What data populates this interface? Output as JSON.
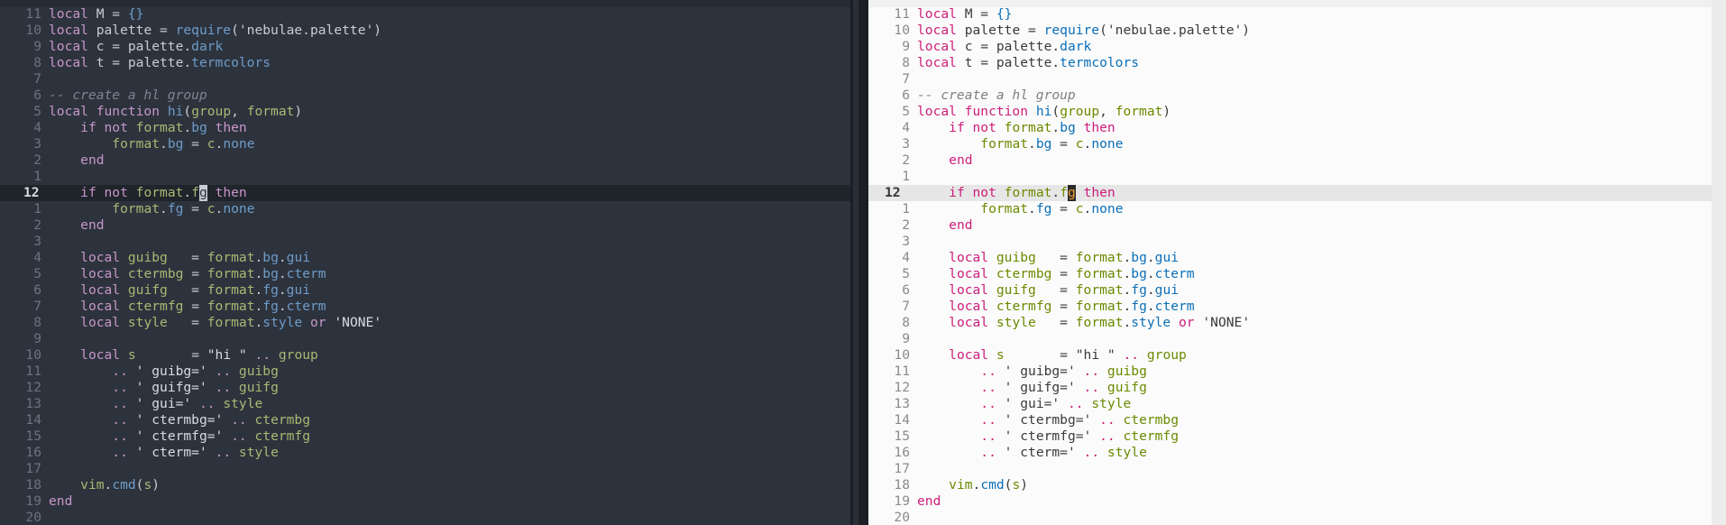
{
  "editor": {
    "lines": [
      {
        "n": "11",
        "parts": [
          [
            "kw",
            "local"
          ],
          [
            "plain",
            " M = "
          ],
          [
            "prop",
            "{}"
          ]
        ]
      },
      {
        "n": "10",
        "parts": [
          [
            "kw",
            "local"
          ],
          [
            "plain",
            " palette = "
          ],
          [
            "prop",
            "require"
          ],
          [
            "plain",
            "('nebulae.palette')"
          ]
        ]
      },
      {
        "n": "9",
        "parts": [
          [
            "kw",
            "local"
          ],
          [
            "plain",
            " c = palette."
          ],
          [
            "prop",
            "dark"
          ]
        ]
      },
      {
        "n": "8",
        "parts": [
          [
            "kw",
            "local"
          ],
          [
            "plain",
            " t = palette."
          ],
          [
            "prop",
            "termcolors"
          ]
        ]
      },
      {
        "n": "7",
        "parts": []
      },
      {
        "n": "6",
        "parts": [
          [
            "cmt",
            "-- create a hl group"
          ]
        ]
      },
      {
        "n": "5",
        "parts": [
          [
            "kw",
            "local function"
          ],
          [
            "plain",
            " "
          ],
          [
            "prop",
            "hi"
          ],
          [
            "plain",
            "("
          ],
          [
            "var",
            "group"
          ],
          [
            "plain",
            ", "
          ],
          [
            "var",
            "format"
          ],
          [
            "plain",
            ")"
          ]
        ]
      },
      {
        "n": "4",
        "parts": [
          [
            "plain",
            "    "
          ],
          [
            "kw",
            "if not"
          ],
          [
            "plain",
            " "
          ],
          [
            "var",
            "format"
          ],
          [
            "plain",
            "."
          ],
          [
            "prop",
            "bg"
          ],
          [
            "plain",
            " "
          ],
          [
            "kw",
            "then"
          ]
        ]
      },
      {
        "n": "3",
        "parts": [
          [
            "plain",
            "        "
          ],
          [
            "var",
            "format"
          ],
          [
            "plain",
            "."
          ],
          [
            "prop",
            "bg"
          ],
          [
            "plain",
            " = "
          ],
          [
            "var",
            "c"
          ],
          [
            "plain",
            "."
          ],
          [
            "prop",
            "none"
          ]
        ]
      },
      {
        "n": "2",
        "parts": [
          [
            "plain",
            "    "
          ],
          [
            "kw",
            "end"
          ]
        ]
      },
      {
        "n": "1",
        "parts": []
      },
      {
        "n": "12",
        "current": true,
        "parts": [
          [
            "plain",
            "    "
          ],
          [
            "kw",
            "if not"
          ],
          [
            "plain",
            " "
          ],
          [
            "var",
            "format"
          ],
          [
            "plain",
            "."
          ],
          [
            "var",
            "f"
          ],
          [
            "cursor",
            "g"
          ],
          [
            "plain",
            " "
          ],
          [
            "kw",
            "then"
          ]
        ]
      },
      {
        "n": "1",
        "parts": [
          [
            "plain",
            "        "
          ],
          [
            "var",
            "format"
          ],
          [
            "plain",
            "."
          ],
          [
            "prop",
            "fg"
          ],
          [
            "plain",
            " = "
          ],
          [
            "var",
            "c"
          ],
          [
            "plain",
            "."
          ],
          [
            "prop",
            "none"
          ]
        ]
      },
      {
        "n": "2",
        "parts": [
          [
            "plain",
            "    "
          ],
          [
            "kw",
            "end"
          ]
        ]
      },
      {
        "n": "3",
        "parts": []
      },
      {
        "n": "4",
        "parts": [
          [
            "plain",
            "    "
          ],
          [
            "kw",
            "local"
          ],
          [
            "plain",
            " "
          ],
          [
            "var",
            "guibg"
          ],
          [
            "plain",
            "   = "
          ],
          [
            "var",
            "format"
          ],
          [
            "plain",
            "."
          ],
          [
            "prop",
            "bg"
          ],
          [
            "plain",
            "."
          ],
          [
            "prop",
            "gui"
          ]
        ]
      },
      {
        "n": "5",
        "parts": [
          [
            "plain",
            "    "
          ],
          [
            "kw",
            "local"
          ],
          [
            "plain",
            " "
          ],
          [
            "var",
            "ctermbg"
          ],
          [
            "plain",
            " = "
          ],
          [
            "var",
            "format"
          ],
          [
            "plain",
            "."
          ],
          [
            "prop",
            "bg"
          ],
          [
            "plain",
            "."
          ],
          [
            "prop",
            "cterm"
          ]
        ]
      },
      {
        "n": "6",
        "parts": [
          [
            "plain",
            "    "
          ],
          [
            "kw",
            "local"
          ],
          [
            "plain",
            " "
          ],
          [
            "var",
            "guifg"
          ],
          [
            "plain",
            "   = "
          ],
          [
            "var",
            "format"
          ],
          [
            "plain",
            "."
          ],
          [
            "prop",
            "fg"
          ],
          [
            "plain",
            "."
          ],
          [
            "prop",
            "gui"
          ]
        ]
      },
      {
        "n": "7",
        "parts": [
          [
            "plain",
            "    "
          ],
          [
            "kw",
            "local"
          ],
          [
            "plain",
            " "
          ],
          [
            "var",
            "ctermfg"
          ],
          [
            "plain",
            " = "
          ],
          [
            "var",
            "format"
          ],
          [
            "plain",
            "."
          ],
          [
            "prop",
            "fg"
          ],
          [
            "plain",
            "."
          ],
          [
            "prop",
            "cterm"
          ]
        ]
      },
      {
        "n": "8",
        "parts": [
          [
            "plain",
            "    "
          ],
          [
            "kw",
            "local"
          ],
          [
            "plain",
            " "
          ],
          [
            "var",
            "style"
          ],
          [
            "plain",
            "   = "
          ],
          [
            "var",
            "format"
          ],
          [
            "plain",
            "."
          ],
          [
            "prop",
            "style"
          ],
          [
            "plain",
            " "
          ],
          [
            "kw",
            "or"
          ],
          [
            "plain",
            " "
          ],
          [
            "str",
            "'NONE'"
          ]
        ]
      },
      {
        "n": "9",
        "parts": []
      },
      {
        "n": "10",
        "parts": [
          [
            "plain",
            "    "
          ],
          [
            "kw",
            "local"
          ],
          [
            "plain",
            " "
          ],
          [
            "var",
            "s"
          ],
          [
            "plain",
            "       = "
          ],
          [
            "str",
            "\"hi \""
          ],
          [
            "plain",
            " "
          ],
          [
            "kw",
            ".."
          ],
          [
            "plain",
            " "
          ],
          [
            "var",
            "group"
          ]
        ]
      },
      {
        "n": "11",
        "parts": [
          [
            "plain",
            "        "
          ],
          [
            "kw",
            ".."
          ],
          [
            "plain",
            " "
          ],
          [
            "str",
            "' guibg='"
          ],
          [
            "plain",
            " "
          ],
          [
            "kw",
            ".."
          ],
          [
            "plain",
            " "
          ],
          [
            "var",
            "guibg"
          ]
        ]
      },
      {
        "n": "12",
        "parts": [
          [
            "plain",
            "        "
          ],
          [
            "kw",
            ".."
          ],
          [
            "plain",
            " "
          ],
          [
            "str",
            "' guifg='"
          ],
          [
            "plain",
            " "
          ],
          [
            "kw",
            ".."
          ],
          [
            "plain",
            " "
          ],
          [
            "var",
            "guifg"
          ]
        ]
      },
      {
        "n": "13",
        "parts": [
          [
            "plain",
            "        "
          ],
          [
            "kw",
            ".."
          ],
          [
            "plain",
            " "
          ],
          [
            "str",
            "' gui='"
          ],
          [
            "plain",
            " "
          ],
          [
            "kw",
            ".."
          ],
          [
            "plain",
            " "
          ],
          [
            "var",
            "style"
          ]
        ]
      },
      {
        "n": "14",
        "parts": [
          [
            "plain",
            "        "
          ],
          [
            "kw",
            ".."
          ],
          [
            "plain",
            " "
          ],
          [
            "str",
            "' ctermbg='"
          ],
          [
            "plain",
            " "
          ],
          [
            "kw",
            ".."
          ],
          [
            "plain",
            " "
          ],
          [
            "var",
            "ctermbg"
          ]
        ]
      },
      {
        "n": "15",
        "parts": [
          [
            "plain",
            "        "
          ],
          [
            "kw",
            ".."
          ],
          [
            "plain",
            " "
          ],
          [
            "str",
            "' ctermfg='"
          ],
          [
            "plain",
            " "
          ],
          [
            "kw",
            ".."
          ],
          [
            "plain",
            " "
          ],
          [
            "var",
            "ctermfg"
          ]
        ]
      },
      {
        "n": "16",
        "parts": [
          [
            "plain",
            "        "
          ],
          [
            "kw",
            ".."
          ],
          [
            "plain",
            " "
          ],
          [
            "str",
            "' cterm='"
          ],
          [
            "plain",
            " "
          ],
          [
            "kw",
            ".."
          ],
          [
            "plain",
            " "
          ],
          [
            "var",
            "style"
          ]
        ]
      },
      {
        "n": "17",
        "parts": []
      },
      {
        "n": "18",
        "parts": [
          [
            "plain",
            "    "
          ],
          [
            "var",
            "vim"
          ],
          [
            "plain",
            "."
          ],
          [
            "prop",
            "cmd"
          ],
          [
            "plain",
            "("
          ],
          [
            "var",
            "s"
          ],
          [
            "plain",
            ")"
          ]
        ]
      },
      {
        "n": "19",
        "parts": [
          [
            "kw",
            "end"
          ]
        ]
      },
      {
        "n": "20",
        "parts": []
      }
    ]
  }
}
